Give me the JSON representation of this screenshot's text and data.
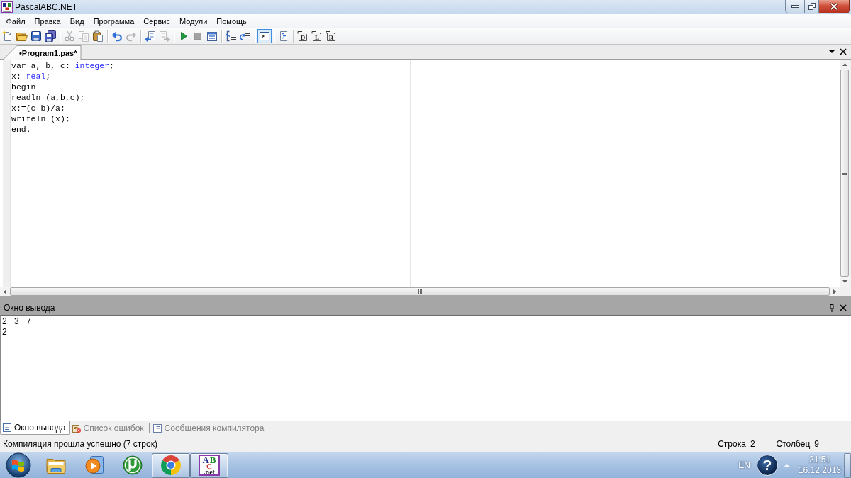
{
  "window": {
    "title": "PascalABC.NET"
  },
  "menu": [
    {
      "label": "Файл"
    },
    {
      "label": "Правка"
    },
    {
      "label": "Вид"
    },
    {
      "label": "Программа"
    },
    {
      "label": "Сервис"
    },
    {
      "label": "Модули"
    },
    {
      "label": "Помощь"
    }
  ],
  "toolbar": [
    [
      {
        "kind": "new",
        "disabled": false,
        "selected": false
      },
      {
        "kind": "open",
        "disabled": false,
        "selected": false
      },
      {
        "kind": "save",
        "disabled": false,
        "selected": false
      },
      {
        "kind": "save-all",
        "disabled": false,
        "selected": false
      }
    ],
    [
      {
        "kind": "cut",
        "disabled": true,
        "selected": false
      },
      {
        "kind": "copy",
        "disabled": true,
        "selected": false
      },
      {
        "kind": "paste",
        "disabled": false,
        "selected": false
      }
    ],
    [
      {
        "kind": "undo",
        "disabled": false,
        "selected": false
      },
      {
        "kind": "redo",
        "disabled": true,
        "selected": false
      }
    ],
    [
      {
        "kind": "back",
        "disabled": false,
        "selected": false
      },
      {
        "kind": "forward",
        "disabled": true,
        "selected": false
      }
    ],
    [
      {
        "kind": "run",
        "disabled": false,
        "selected": false
      },
      {
        "kind": "stop",
        "disabled": true,
        "selected": false
      },
      {
        "kind": "compile",
        "disabled": false,
        "selected": false
      }
    ],
    [
      {
        "kind": "step-into",
        "disabled": false,
        "selected": false
      },
      {
        "kind": "step-over",
        "disabled": false,
        "selected": false
      }
    ],
    [
      {
        "kind": "console",
        "disabled": false,
        "selected": true
      }
    ],
    [
      {
        "kind": "document",
        "disabled": false,
        "selected": false
      }
    ],
    [
      {
        "kind": "lettered",
        "glyph": "D",
        "disabled": false,
        "selected": false
      },
      {
        "kind": "lettered",
        "glyph": "L",
        "disabled": false,
        "selected": false
      },
      {
        "kind": "lettered",
        "glyph": "R",
        "disabled": false,
        "selected": false
      }
    ]
  ],
  "doc_tabs": [
    {
      "label": "•Program1.pas*",
      "selected": true
    }
  ],
  "editor": {
    "lines": [
      [
        {
          "text": "var a, b, c: ",
          "kind": "plain"
        },
        {
          "text": "integer",
          "kind": "type"
        },
        {
          "text": ";",
          "kind": "plain"
        }
      ],
      [
        {
          "text": "x: ",
          "kind": "plain"
        },
        {
          "text": "real",
          "kind": "type"
        },
        {
          "text": ";",
          "kind": "plain"
        }
      ],
      [
        {
          "text": "begin",
          "kind": "plain"
        }
      ],
      [
        {
          "text": "readln (a,b,c);",
          "kind": "plain"
        }
      ],
      [
        {
          "text": "x:=(c-b)/a;",
          "kind": "plain"
        }
      ],
      [
        {
          "text": "writeln (x);",
          "kind": "plain"
        }
      ],
      [
        {
          "text": "end.",
          "kind": "plain"
        }
      ]
    ]
  },
  "output": {
    "title": "Окно вывода",
    "lines": [
      "2 3 7",
      "2"
    ]
  },
  "bottom_tabs": [
    {
      "label": "Окно вывода",
      "kind": "output",
      "selected": true
    },
    {
      "label": "Список ошибок",
      "kind": "errors",
      "selected": false
    },
    {
      "label": "Сообщения компилятора",
      "kind": "messages",
      "selected": false
    }
  ],
  "status_bar": {
    "message": "Компиляция прошла успешно (7 строк)",
    "line_label": "Строка",
    "line": "2",
    "column_label": "Столбец",
    "column": "9"
  },
  "taskbar": {
    "apps": [
      {
        "kind": "explorer",
        "open": false
      },
      {
        "kind": "media-player",
        "open": false
      },
      {
        "kind": "torrent",
        "open": false
      },
      {
        "kind": "browser",
        "open": true
      },
      {
        "kind": "pascal",
        "open": true,
        "logo": [
          "A",
          "B",
          "C",
          ".net"
        ]
      }
    ],
    "tray": {
      "language": "EN",
      "help": "?",
      "time": "21:51",
      "date": "16.12.2013"
    }
  }
}
